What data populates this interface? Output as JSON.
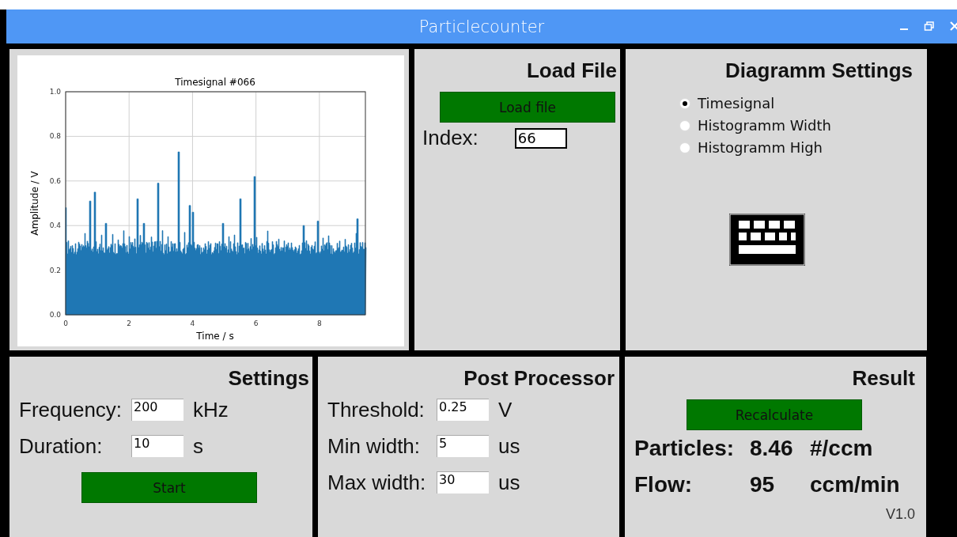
{
  "window": {
    "title": "Particlecounter"
  },
  "plot": {
    "title": "Timesignal #066",
    "xlabel": "Time / s",
    "ylabel": "Amplitude / V",
    "xticks": [
      "0",
      "2",
      "4",
      "6",
      "8"
    ],
    "yticks": [
      "1.0",
      "0.8",
      "0.6",
      "0.4",
      "0.2",
      "0.0"
    ]
  },
  "load_file": {
    "heading": "Load File",
    "button": "Load file",
    "index_label": "Index:",
    "index_value": "66"
  },
  "diagram_settings": {
    "heading": "Diagramm Settings",
    "options": [
      {
        "label": "Timesignal",
        "selected": true
      },
      {
        "label": "Histogramm Width",
        "selected": false
      },
      {
        "label": "Histogramm High",
        "selected": false
      }
    ]
  },
  "settings": {
    "heading": "Settings",
    "fields": [
      {
        "label": "Frequency:",
        "value": "200",
        "unit": "kHz"
      },
      {
        "label": "Duration:",
        "value": "10",
        "unit": "s"
      }
    ],
    "button": "Start"
  },
  "post_processor": {
    "heading": "Post Processor",
    "fields": [
      {
        "label": "Threshold:",
        "value": "0.25",
        "unit": "V"
      },
      {
        "label": "Min width:",
        "value": "5",
        "unit": "us"
      },
      {
        "label": "Max width:",
        "value": "30",
        "unit": "us"
      }
    ]
  },
  "result": {
    "heading": "Result",
    "button": "Recalculate",
    "rows": [
      {
        "label": "Particles:",
        "value": "8.46",
        "unit": "#/ccm"
      },
      {
        "label": "Flow:",
        "value": "95",
        "unit": "ccm/min"
      }
    ],
    "version": "V1.0"
  }
}
